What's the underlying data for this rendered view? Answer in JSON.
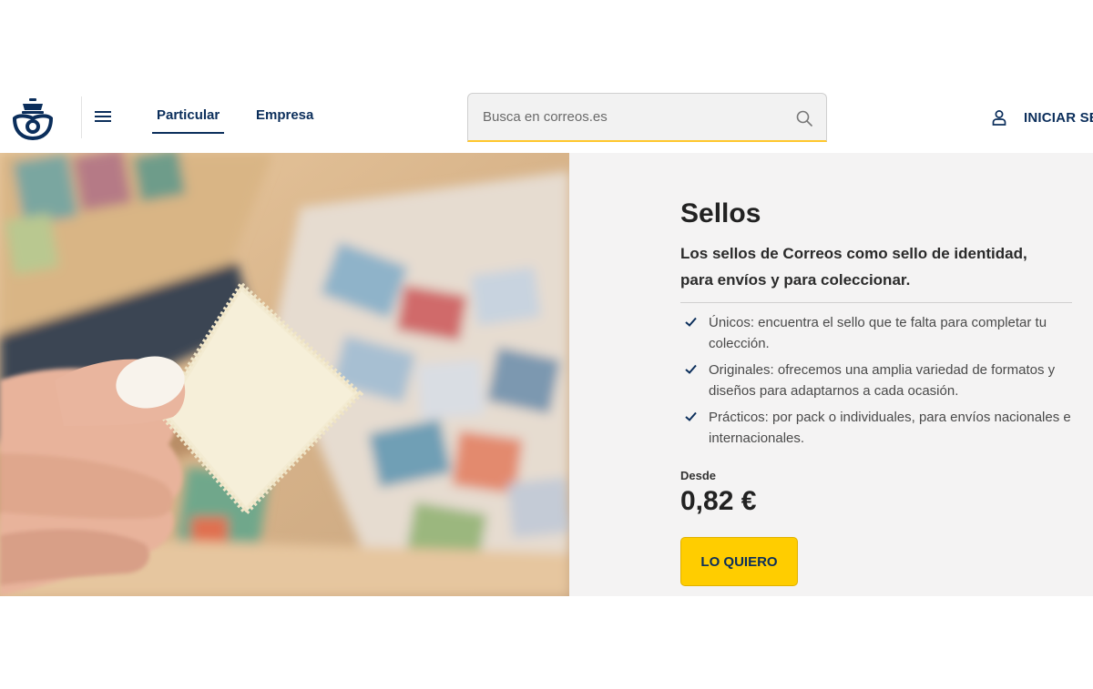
{
  "header": {
    "logo_icon": "correos-crown-horn-logo",
    "menu_icon": "hamburger-menu-icon",
    "tabs": [
      {
        "label": "Particular",
        "active": true
      },
      {
        "label": "Empresa",
        "active": false
      }
    ],
    "search": {
      "placeholder": "Busca en correos.es",
      "value": "",
      "icon": "search-icon"
    },
    "login": {
      "icon": "user-icon",
      "label": "INICIAR SE"
    }
  },
  "hero": {
    "image": "hand-holding-stamp-over-stamp-collection",
    "title": "Sellos",
    "subtitle": "Los sellos de Correos como sello de identidad, para envíos y para coleccionar.",
    "features": [
      "Únicos: encuentra el sello que te falta para completar tu colección.",
      "Originales: ofrecemos una amplia variedad de formatos y diseños para adaptarnos a cada ocasión.",
      "Prácticos: por pack o individuales, para envíos nacionales e internacionales."
    ],
    "price_label": "Desde",
    "price": "0,82 €",
    "cta_label": "LO QUIERO"
  },
  "colors": {
    "brand_navy": "#0b2e5b",
    "brand_yellow": "#ffcd00",
    "panel_bg": "#f4f3f3"
  }
}
